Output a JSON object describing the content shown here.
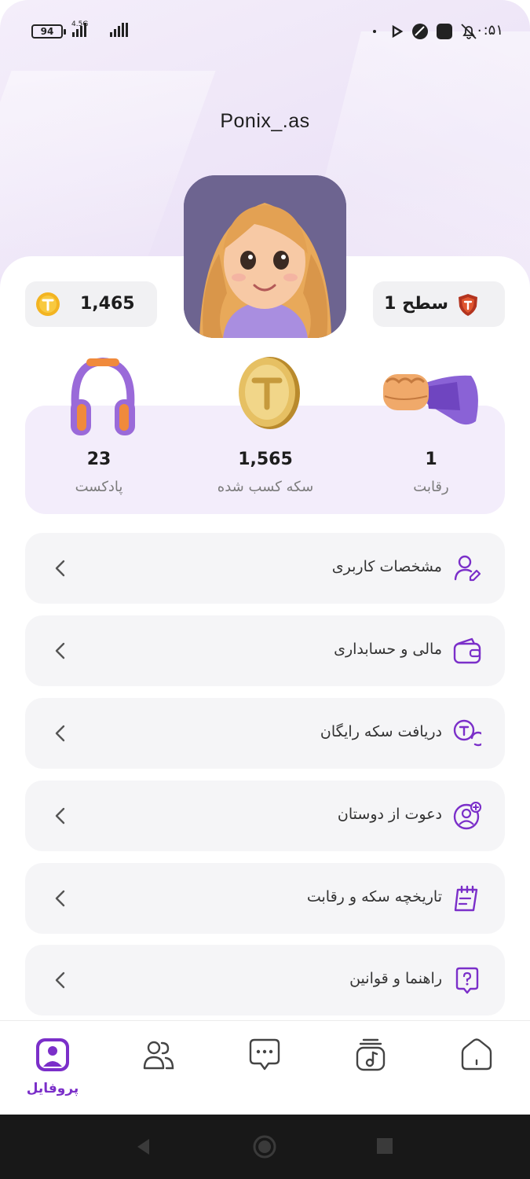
{
  "status_bar": {
    "battery": "94",
    "network": "4.5G",
    "time": "۰:۵۱"
  },
  "profile": {
    "username": "Ponix_.as",
    "coins": "1,465",
    "level": "سطح 1"
  },
  "stats": [
    {
      "value": "1",
      "label": "رقابت",
      "icon": "fist-icon"
    },
    {
      "value": "1,565",
      "label": "سکه کسب شده",
      "icon": "gold-coin-icon"
    },
    {
      "value": "23",
      "label": "پادکست",
      "icon": "headphones-icon"
    }
  ],
  "menu": [
    {
      "label": "مشخصات کاربری",
      "icon": "user-edit-icon"
    },
    {
      "label": "مالی و حسابداری",
      "icon": "wallet-icon"
    },
    {
      "label": "دریافت سکه رایگان",
      "icon": "coin-search-icon"
    },
    {
      "label": "دعوت از دوستان",
      "icon": "user-add-icon"
    },
    {
      "label": "تاریخچه سکه و رقابت",
      "icon": "calendar-edit-icon"
    },
    {
      "label": "راهنما و قوانین",
      "icon": "help-icon"
    }
  ],
  "bottom_nav": {
    "active_label": "پروفایل",
    "items": [
      "profile-icon",
      "users-icon",
      "chat-icon",
      "music-icon",
      "home-icon"
    ]
  },
  "colors": {
    "accent": "#7b2fc9",
    "stats_bg": "#f3edfb",
    "menu_bg": "#f5f5f7"
  }
}
